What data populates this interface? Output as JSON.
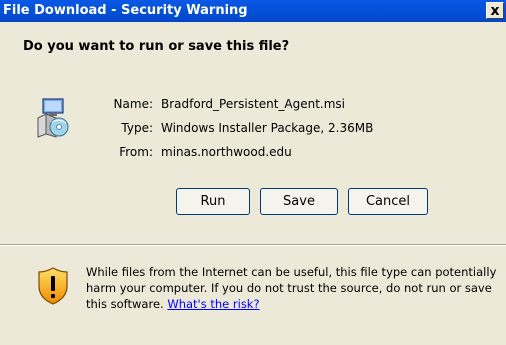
{
  "window": {
    "title": "File Download - Security Warning",
    "close_label": "x"
  },
  "dialog": {
    "question": "Do you want to run or save this file?",
    "name_label": "Name:",
    "name_value": "Bradford_Persistent_Agent.msi",
    "type_label": "Type:",
    "type_value": "Windows Installer Package, 2.36MB",
    "from_label": "From:",
    "from_value": "minas.northwood.edu"
  },
  "buttons": {
    "run": "Run",
    "save": "Save",
    "cancel": "Cancel"
  },
  "warning": {
    "text": "While files from the Internet can be useful, this file type can potentially harm your computer. If you do not trust the source, do not run or save this software.",
    "link": "What's the risk?"
  },
  "colors": {
    "title_bar": "#0552d9",
    "dialog_bg": "#ece9d8",
    "link": "#0000ff"
  },
  "icons": {
    "file": "installer-package-icon",
    "warning": "security-shield-icon"
  }
}
